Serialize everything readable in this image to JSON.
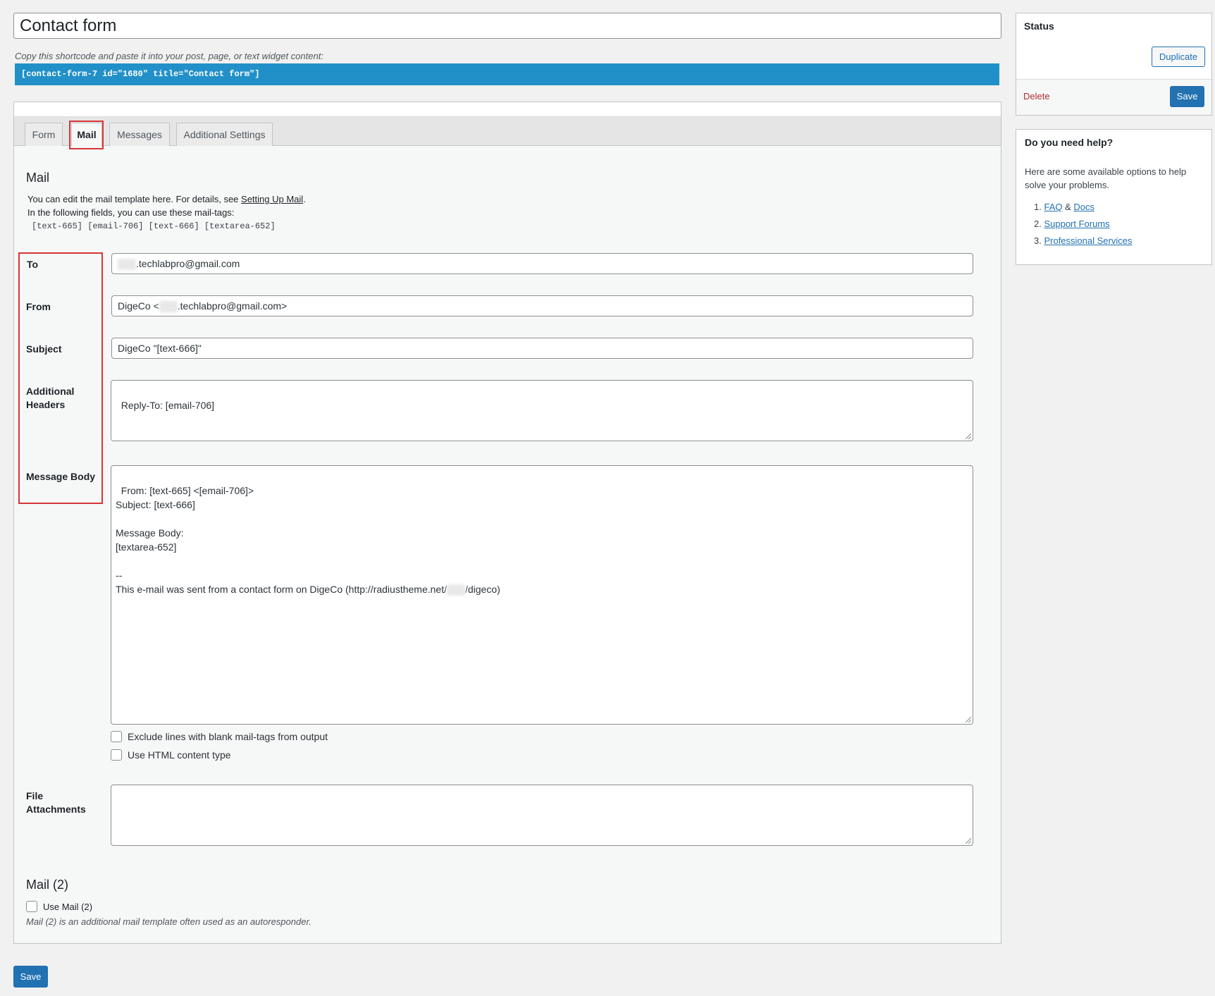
{
  "title": {
    "value": "Contact form"
  },
  "shortcode": {
    "hint": "Copy this shortcode and paste it into your post, page, or text widget content:",
    "code": "[contact-form-7 id=\"1680\" title=\"Contact form\"]"
  },
  "tabs": [
    {
      "label": "Form"
    },
    {
      "label": "Mail",
      "active": true
    },
    {
      "label": "Messages"
    },
    {
      "label": "Additional Settings"
    }
  ],
  "mail": {
    "heading": "Mail",
    "desc_prefix": "You can edit the mail template here. For details, see ",
    "desc_link": "Setting Up Mail",
    "desc_suffix": ".",
    "desc_line2": "In the following fields, you can use these mail-tags:",
    "mail_tags": "[text-665] [email-706] [text-666] [textarea-652]",
    "fields": {
      "to": {
        "label": "To",
        "value": ".techlabpro@gmail.com"
      },
      "from": {
        "label": "From",
        "value_prefix": "DigeCo <",
        "value_suffix": ".techlabpro@gmail.com>"
      },
      "subject": {
        "label": "Subject",
        "value": "DigeCo \"[text-666]\""
      },
      "additional_headers": {
        "label_line1": "Additional",
        "label_line2": "Headers",
        "value": "Reply-To: [email-706]"
      },
      "message_body": {
        "label": "Message Body",
        "value": "From: [text-665] <[email-706]>\nSubject: [text-666]\n\nMessage Body:\n[textarea-652]\n\n--\nThis e-mail was sent from a contact form on DigeCo (http://radiustheme.net/",
        "value_tail": "/digeco)"
      },
      "file_attachments": {
        "label_line1": "File",
        "label_line2": "Attachments",
        "value": ""
      }
    },
    "options": {
      "exclude_blank": "Exclude lines with blank mail-tags from output",
      "use_html": "Use HTML content type"
    }
  },
  "mail2": {
    "heading": "Mail (2)",
    "checkbox_label": "Use Mail (2)",
    "note": "Mail (2) is an additional mail template often used as an autoresponder."
  },
  "bottom_save": "Save",
  "sidebar": {
    "status": {
      "title": "Status",
      "duplicate": "Duplicate",
      "delete": "Delete",
      "save": "Save"
    },
    "help": {
      "title": "Do you need help?",
      "text": "Here are some available options to help solve your problems.",
      "item1_num": "1.",
      "item1_link_a": "FAQ",
      "item1_amp": " & ",
      "item1_link_b": "Docs",
      "item2_num": "2.",
      "item2_link": "Support Forums",
      "item3_num": "3.",
      "item3_link": "Professional Services"
    }
  },
  "colors": {
    "accent": "#2271b1",
    "shortcode_bg": "#2290c8",
    "highlight": "#d63638",
    "delete": "#b32d2e"
  }
}
